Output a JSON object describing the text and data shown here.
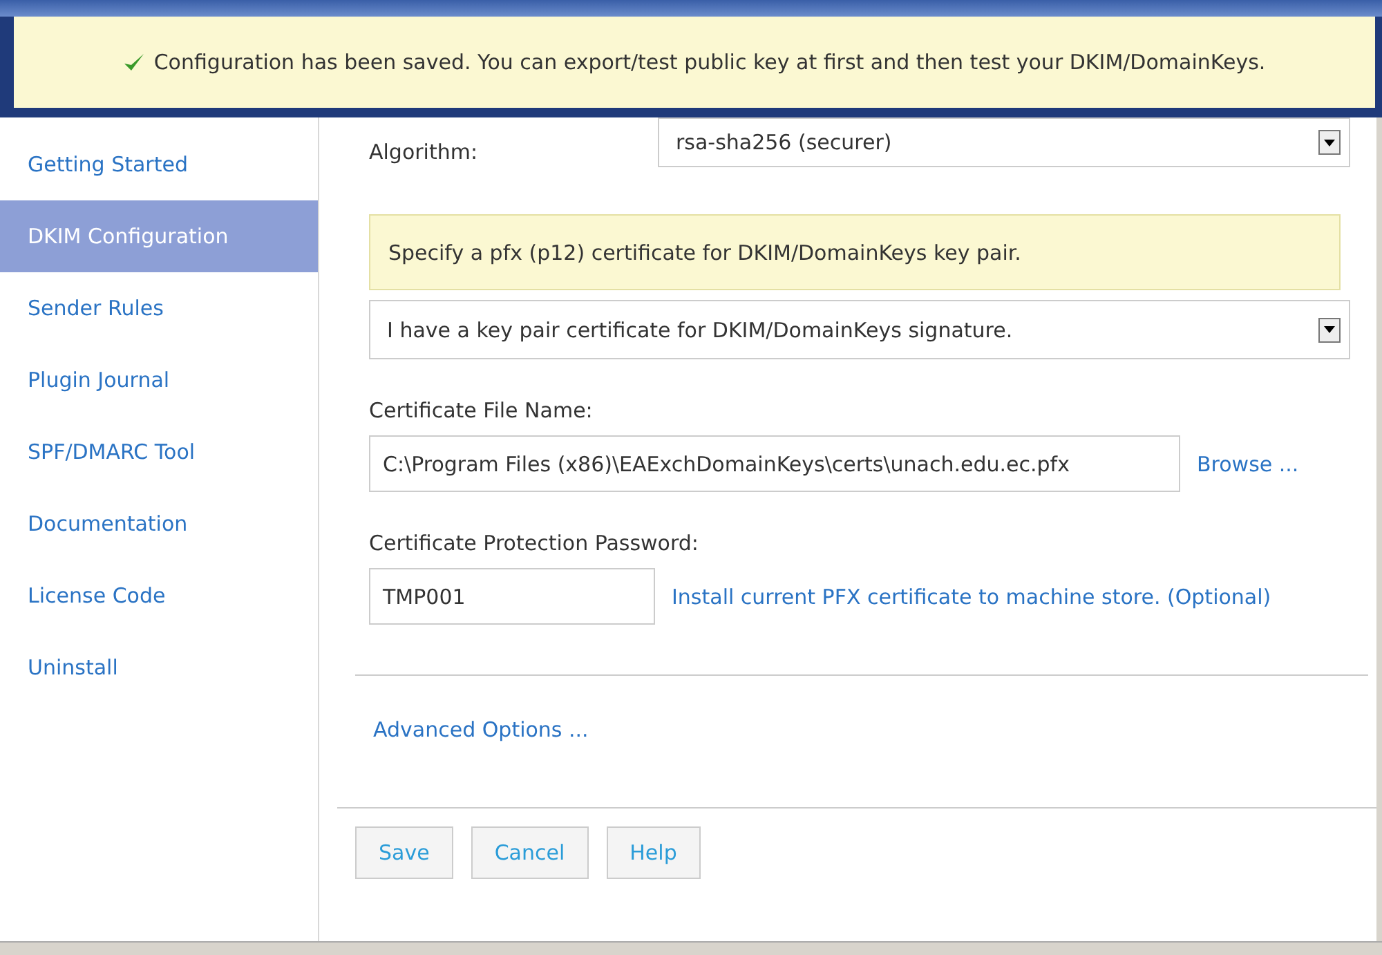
{
  "notification": {
    "kind": "success",
    "text": "Configuration has been saved. You can export/test public key at first and then test your DKIM/DomainKeys."
  },
  "sidebar": {
    "items": [
      {
        "label": "Getting Started",
        "selected": false
      },
      {
        "label": "DKIM Configuration",
        "selected": true
      },
      {
        "label": "Sender Rules",
        "selected": false
      },
      {
        "label": "Plugin Journal",
        "selected": false
      },
      {
        "label": "SPF/DMARC Tool",
        "selected": false
      },
      {
        "label": "Documentation",
        "selected": false
      },
      {
        "label": "License Code",
        "selected": false
      },
      {
        "label": "Uninstall",
        "selected": false
      }
    ]
  },
  "algorithm": {
    "label": "Algorithm:",
    "value": "rsa-sha256 (securer)"
  },
  "hint": "Specify a pfx (p12) certificate for DKIM/DomainKeys key pair.",
  "key_source": {
    "value": "I have a key pair certificate for DKIM/DomainKeys signature."
  },
  "certificate_file": {
    "label": "Certificate File Name:",
    "value": "C:\\Program Files (x86)\\EAExchDomainKeys\\certs\\unach.edu.ec.pfx",
    "link": "Browse ..."
  },
  "password": {
    "label": "Certificate Protection Password:",
    "value": "TMP001",
    "link": "Install current PFX certificate to machine store. (Optional)"
  },
  "advanced_link": "Advanced Options ...",
  "buttons": [
    "Save",
    "Cancel",
    "Help"
  ]
}
